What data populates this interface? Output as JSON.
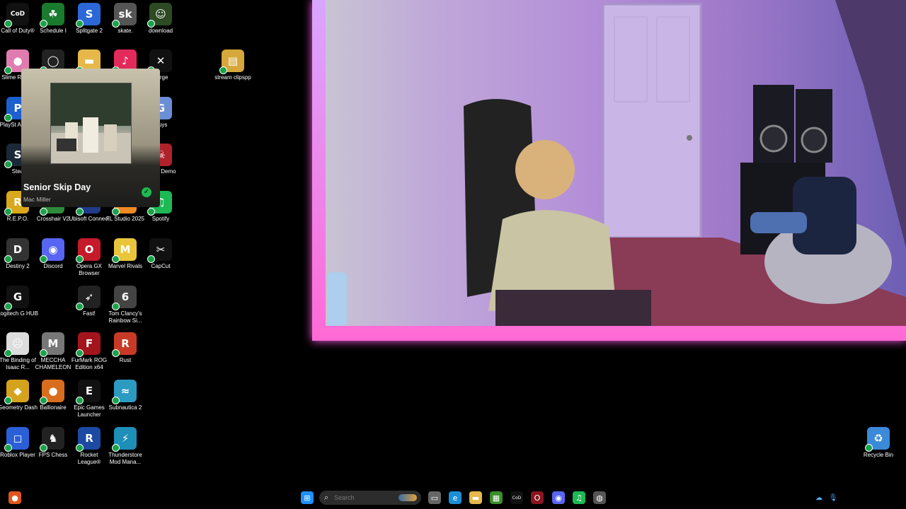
{
  "desktop": {
    "icons": [
      {
        "label": "Call of Duty®",
        "glyph": "CoD",
        "color": "#111"
      },
      {
        "label": "Schedule I",
        "glyph": "☘",
        "color": "#1a7a2e"
      },
      {
        "label": "Splitgate 2",
        "glyph": "S",
        "color": "#2b67d6"
      },
      {
        "label": "skate.",
        "glyph": "sk",
        "color": "#555"
      },
      {
        "label": "download",
        "glyph": "☺",
        "color": "#2d4a22"
      },
      {
        "label": "Slime Ranch",
        "glyph": "●",
        "color": "#e07bb0"
      },
      {
        "label": "",
        "glyph": "◯",
        "color": "#222"
      },
      {
        "label": "",
        "glyph": "▬",
        "color": "#e6b84a"
      },
      {
        "label": "",
        "glyph": "♪",
        "color": "#e22a5b"
      },
      {
        "label": "Forge",
        "glyph": "✕",
        "color": "#111"
      },
      {
        "label": "PlaySt Access",
        "glyph": "P",
        "color": "#1c5fcf"
      },
      {
        "label": "Guys",
        "glyph": "G",
        "color": "#6b8ed6"
      },
      {
        "label": "Stea",
        "glyph": "S",
        "color": "#1b2838"
      },
      {
        "label": "Many Demo",
        "glyph": "☠",
        "color": "#b0222a"
      },
      {
        "label": "R.E.P.O.",
        "glyph": "R",
        "color": "#d9a81c"
      },
      {
        "label": "Crosshair V2",
        "glyph": "⊕",
        "color": "#2f8a3c"
      },
      {
        "label": "Ubisoft Connect",
        "glyph": "U",
        "color": "#1f3b8a"
      },
      {
        "label": "FL Studio 2025",
        "glyph": "FL",
        "color": "#f08a24"
      },
      {
        "label": "Spotify",
        "glyph": "♫",
        "color": "#1db954"
      },
      {
        "label": "Destiny 2",
        "glyph": "D",
        "color": "#333"
      },
      {
        "label": "Discord",
        "glyph": "◉",
        "color": "#5865f2"
      },
      {
        "label": "Opera GX Browser",
        "glyph": "O",
        "color": "#c41a2a"
      },
      {
        "label": "Marvel Rivals",
        "glyph": "M",
        "color": "#e9c53a"
      },
      {
        "label": "CapCut",
        "glyph": "✂",
        "color": "#111"
      },
      {
        "label": "Logitech G HUB",
        "glyph": "G",
        "color": "#111"
      },
      {
        "label": "Fast!",
        "glyph": "➶",
        "color": "#222"
      },
      {
        "label": "Tom Clancy's Rainbow Si...",
        "glyph": "6",
        "color": "#444"
      },
      {
        "label": "The Binding of Isaac R...",
        "glyph": "☹",
        "color": "#ddd"
      },
      {
        "label": "MECCHA CHAMELEON",
        "glyph": "M",
        "color": "#777"
      },
      {
        "label": "FurMark ROG Edition x64",
        "glyph": "F",
        "color": "#a3151c"
      },
      {
        "label": "Rust",
        "glyph": "R",
        "color": "#c93a26"
      },
      {
        "label": "Geometry Dash",
        "glyph": "◆",
        "color": "#d5a21b"
      },
      {
        "label": "Ballionaire",
        "glyph": "●",
        "color": "#d96d1e"
      },
      {
        "label": "Epic Games Launcher",
        "glyph": "E",
        "color": "#111"
      },
      {
        "label": "Subnautica 2",
        "glyph": "≈",
        "color": "#2b9bc2"
      },
      {
        "label": "Roblox Player",
        "glyph": "◻",
        "color": "#2a5fd8"
      },
      {
        "label": "FPS Chess",
        "glyph": "♞",
        "color": "#222"
      },
      {
        "label": "Rocket League®",
        "glyph": "R",
        "color": "#1c4aa3"
      },
      {
        "label": "Thunderstore Mod Mana...",
        "glyph": "⚡",
        "color": "#1d8fb8"
      },
      {
        "label": "stream clipspp",
        "glyph": "▤",
        "color": "#d6a73a"
      },
      {
        "label": "Recycle Bin",
        "glyph": "♻",
        "color": "#3b8ad9"
      }
    ]
  },
  "now_playing": {
    "title": "Senior Skip Day",
    "artist": "Mac Miller"
  },
  "taskbar": {
    "search_placeholder": "Search",
    "apps": [
      {
        "name": "start-button",
        "glyph": "⊞",
        "color": "#1e90ff"
      },
      {
        "name": "task-view-icon",
        "glyph": "▭",
        "color": "#666"
      },
      {
        "name": "edge-icon",
        "glyph": "e",
        "color": "#1a8fd6"
      },
      {
        "name": "file-explorer-icon",
        "glyph": "▬",
        "color": "#e6b84a"
      },
      {
        "name": "minecraft-icon",
        "glyph": "▦",
        "color": "#3a8c2a"
      },
      {
        "name": "call-of-duty-icon",
        "glyph": "CoD",
        "color": "#111"
      },
      {
        "name": "opera-gx-icon",
        "glyph": "O",
        "color": "#8a1620"
      },
      {
        "name": "discord-icon",
        "glyph": "◉",
        "color": "#5865f2"
      },
      {
        "name": "spotify-icon",
        "glyph": "♫",
        "color": "#1db954"
      },
      {
        "name": "chrome-icon",
        "glyph": "◍",
        "color": "#555"
      }
    ]
  }
}
